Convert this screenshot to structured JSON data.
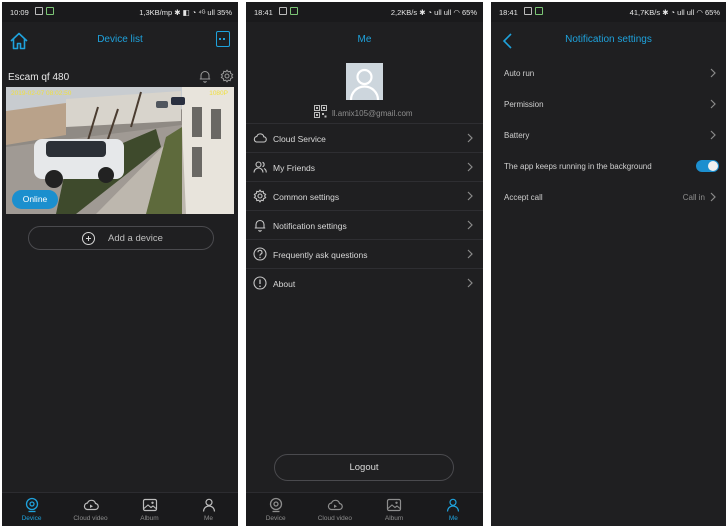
{
  "panels": {
    "device_list": {
      "status": {
        "time": "10:09",
        "right": "1,3KB/mp ✱ ◧ ◔ ⁴ᴳ ull 35%"
      },
      "title": "Device list",
      "camera": {
        "name": "Escam qf 480",
        "timestamp": "2019-02-07 08:02:50",
        "resolution": "1080P",
        "status": "Online"
      },
      "add_device_label": "Add a device",
      "tabs": [
        {
          "label": "Device",
          "icon": "device-icon",
          "active": true
        },
        {
          "label": "Cloud video",
          "icon": "cloud-video-icon",
          "active": false
        },
        {
          "label": "Album",
          "icon": "album-icon",
          "active": false
        },
        {
          "label": "Me",
          "icon": "me-icon",
          "active": false
        }
      ]
    },
    "me": {
      "status": {
        "time": "18:41",
        "right": "2,2KB/s ✱ ◔ ull ull ◠ 65%"
      },
      "title": "Me",
      "email": "ll.amix105@gmail.com",
      "menu": [
        {
          "label": "Cloud Service",
          "icon": "cloud-icon"
        },
        {
          "label": "My Friends",
          "icon": "friends-icon"
        },
        {
          "label": "Common settings",
          "icon": "gear-icon"
        },
        {
          "label": "Notification settings",
          "icon": "bell-icon"
        },
        {
          "label": "Frequently ask questions",
          "icon": "question-icon"
        },
        {
          "label": "About",
          "icon": "info-icon"
        }
      ],
      "logout_label": "Logout",
      "tabs": [
        {
          "label": "Device",
          "icon": "device-icon",
          "active": false
        },
        {
          "label": "Cloud video",
          "icon": "cloud-video-icon",
          "active": false
        },
        {
          "label": "Album",
          "icon": "album-icon",
          "active": false
        },
        {
          "label": "Me",
          "icon": "me-icon",
          "active": true
        }
      ]
    },
    "notification_settings": {
      "status": {
        "time": "18:41",
        "right": "41,7KB/s ✱ ◔ ull ull ◠ 65%"
      },
      "title": "Notification settings",
      "rows": [
        {
          "label": "Auto run",
          "kind": "chevron"
        },
        {
          "label": "Permission",
          "kind": "chevron"
        },
        {
          "label": "Battery",
          "kind": "chevron"
        },
        {
          "label": "The app keeps running in the background",
          "kind": "toggle",
          "on": true
        },
        {
          "label": "Accept call",
          "kind": "value",
          "value": "Call in"
        }
      ]
    }
  },
  "colors": {
    "accent": "#1fa2dc",
    "background": "#1f1f21",
    "toggle_on": "#1c8fcf",
    "online_badge": "#1b8fce"
  }
}
